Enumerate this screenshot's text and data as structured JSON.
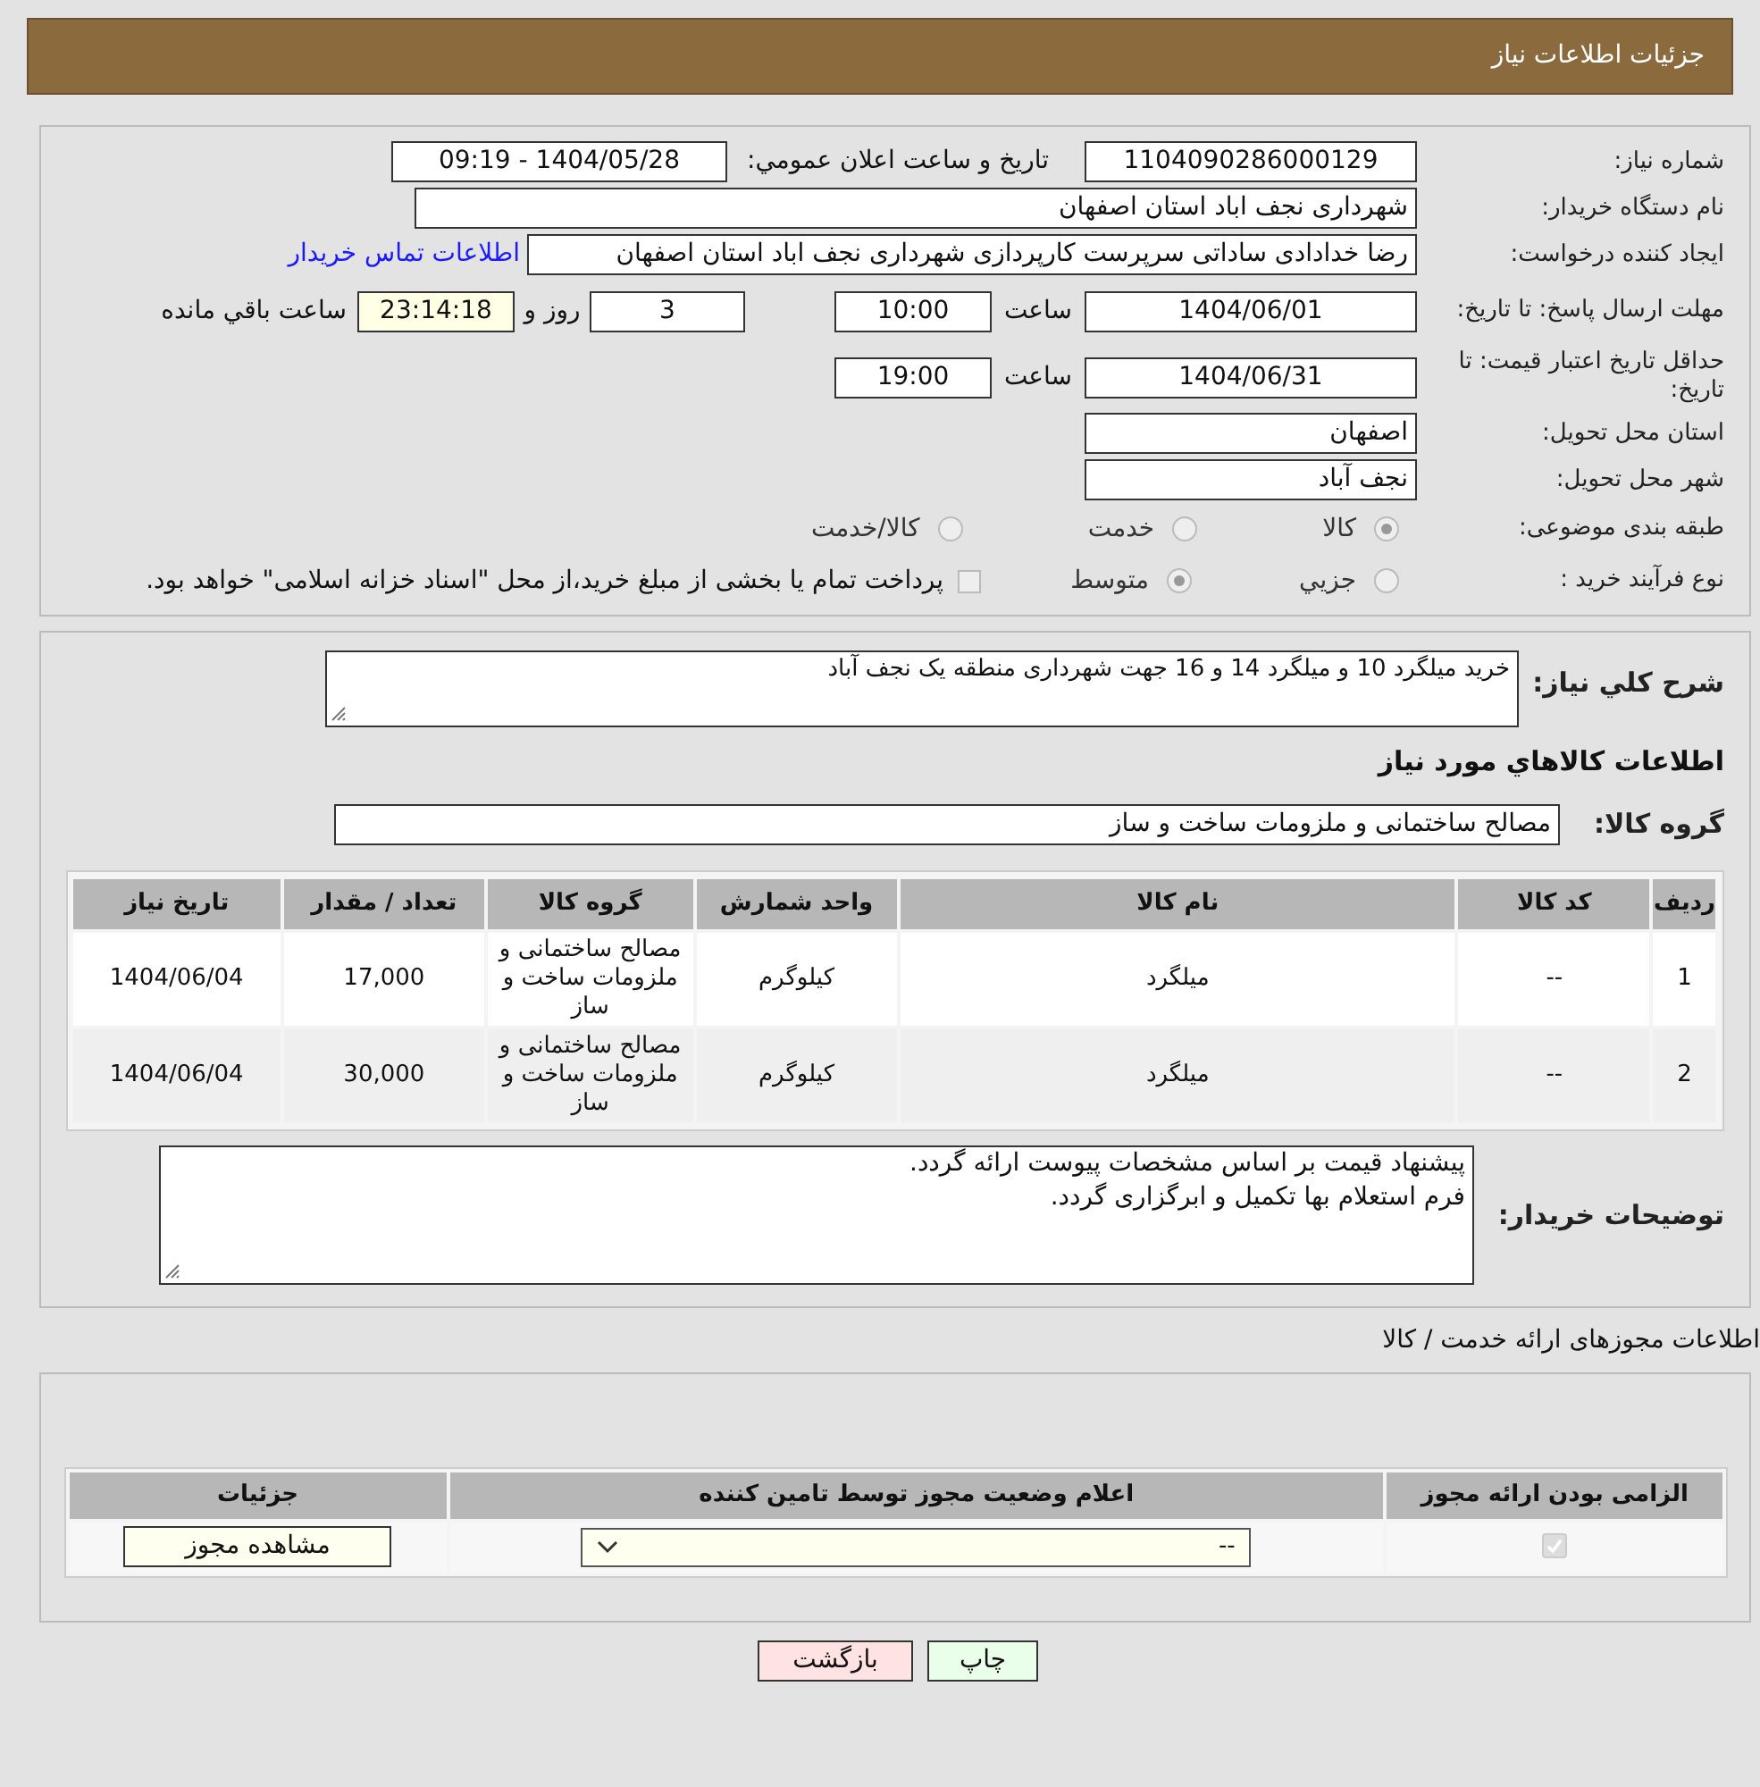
{
  "header": {
    "title": "جزئیات اطلاعات نیاز"
  },
  "details": {
    "need_number": {
      "label": "شماره نیاز:",
      "value": "1104090286000129"
    },
    "announce": {
      "label": "تاریخ و ساعت اعلان عمومي:",
      "value": "1404/05/28 - 09:19"
    },
    "buyer": {
      "label": "نام دستگاه خریدار:",
      "value": "شهرداری نجف اباد استان اصفهان"
    },
    "creator": {
      "label": "ایجاد کننده درخواست:",
      "value": "رضا خدادادی ساداتی سرپرست  کارپردازی شهرداری نجف اباد استان اصفهان",
      "link": "اطلاعات تماس خریدار"
    },
    "deadline": {
      "label": "مهلت ارسال پاسخ: تا تاریخ:",
      "date": "1404/06/01",
      "time_label": "ساعت",
      "time": "10:00",
      "days": "3",
      "days_label": "روز و",
      "remaining": "23:14:18",
      "remaining_label": "ساعت باقي مانده"
    },
    "validity": {
      "label": "حداقل تاریخ اعتبار قیمت: تا تاریخ:",
      "date": "1404/06/31",
      "time_label": "ساعت",
      "time": "19:00"
    },
    "province": {
      "label": "استان محل تحویل:",
      "value": "اصفهان"
    },
    "city": {
      "label": "شهر محل تحویل:",
      "value": "نجف آباد"
    },
    "category": {
      "label": "طبقه بندی موضوعی:",
      "options": [
        {
          "label": "کالا",
          "selected": true
        },
        {
          "label": "خدمت",
          "selected": false
        },
        {
          "label": "کالا/خدمت",
          "selected": false
        }
      ]
    },
    "process": {
      "label": "نوع فرآیند خرید :",
      "options": [
        {
          "label": "جزيي",
          "selected": false
        },
        {
          "label": "متوسط",
          "selected": true
        }
      ],
      "treasury": {
        "label": "پرداخت تمام یا بخشی از مبلغ خرید،از محل \"اسناد خزانه اسلامی\" خواهد بود.",
        "checked": false
      }
    }
  },
  "goods": {
    "description": {
      "label": "شرح کلي نیاز:",
      "value": "خرید میلگرد 10 و میلگرد 14 و 16 جهت شهرداری منطقه یک نجف آباد"
    },
    "heading": "اطلاعات کالاهاي مورد نیاز",
    "group": {
      "label": "گروه کالا:",
      "value": "مصالح ساختمانی و ملزومات ساخت و ساز"
    },
    "table": {
      "columns": [
        "ردیف",
        "کد کالا",
        "نام کالا",
        "واحد شمارش",
        "گروه کالا",
        "تعداد / مقدار",
        "تاریخ نیاز"
      ],
      "rows": [
        [
          "1",
          "--",
          "میلگرد",
          "کیلوگرم",
          "مصالح ساختمانی و ملزومات ساخت و ساز",
          "17,000",
          "1404/06/04"
        ],
        [
          "2",
          "--",
          "میلگرد",
          "کیلوگرم",
          "مصالح ساختمانی و ملزومات ساخت و ساز",
          "30,000",
          "1404/06/04"
        ]
      ]
    },
    "notes": {
      "label": "توضیحات خریدار:",
      "lines": [
        "پیشنهاد قیمت بر اساس مشخصات پیوست ارائه گردد.",
        "فرم استعلام بها تکمیل و ابرگزاری گردد."
      ]
    }
  },
  "permits": {
    "title": "اطلاعات مجوزهای ارائه خدمت / کالا",
    "columns": [
      "الزامی بودن ارائه مجوز",
      "اعلام وضعیت مجوز توسط تامین کننده",
      "جزئیات"
    ],
    "rows": [
      {
        "required": true,
        "status": "--",
        "action": "مشاهده مجوز"
      }
    ]
  },
  "buttons": [
    {
      "kind": "print",
      "label": "چاپ"
    },
    {
      "kind": "back",
      "label": "بازگشت"
    }
  ]
}
